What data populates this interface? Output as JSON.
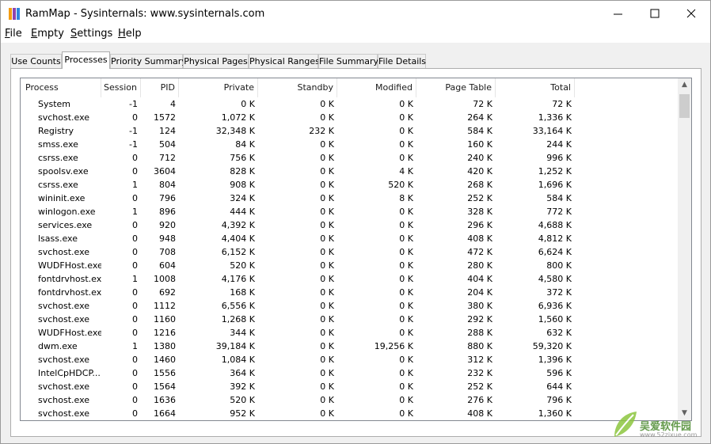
{
  "window": {
    "title": "RamMap - Sysinternals: www.sysinternals.com",
    "icon": "rammap-app-icon",
    "controls": {
      "minimize": "─",
      "maximize": "☐",
      "close": "✕"
    }
  },
  "menu": [
    {
      "label": "File",
      "access": "F",
      "rest": "ile"
    },
    {
      "label": "Empty",
      "access": "E",
      "rest": "mpty"
    },
    {
      "label": "Settings",
      "access": "S",
      "rest": "ettings"
    },
    {
      "label": "Help",
      "access": "H",
      "rest": "elp"
    }
  ],
  "tabs": [
    {
      "label": "Use Counts",
      "active": false
    },
    {
      "label": "Processes",
      "active": true
    },
    {
      "label": "Priority Summary",
      "active": false
    },
    {
      "label": "Physical Pages",
      "active": false
    },
    {
      "label": "Physical Ranges",
      "active": false
    },
    {
      "label": "File Summary",
      "active": false
    },
    {
      "label": "File Details",
      "active": false
    }
  ],
  "table": {
    "columns": [
      "Process",
      "Session",
      "PID",
      "Private",
      "Standby",
      "Modified",
      "Page Table",
      "Total"
    ],
    "rows": [
      [
        "System",
        "-1",
        "4",
        "0 K",
        "0 K",
        "0 K",
        "72 K",
        "72 K"
      ],
      [
        "svchost.exe",
        "0",
        "1572",
        "1,072 K",
        "0 K",
        "0 K",
        "264 K",
        "1,336 K"
      ],
      [
        "Registry",
        "-1",
        "124",
        "32,348 K",
        "232 K",
        "0 K",
        "584 K",
        "33,164 K"
      ],
      [
        "smss.exe",
        "-1",
        "504",
        "84 K",
        "0 K",
        "0 K",
        "160 K",
        "244 K"
      ],
      [
        "csrss.exe",
        "0",
        "712",
        "756 K",
        "0 K",
        "0 K",
        "240 K",
        "996 K"
      ],
      [
        "spoolsv.exe",
        "0",
        "3604",
        "828 K",
        "0 K",
        "4 K",
        "420 K",
        "1,252 K"
      ],
      [
        "csrss.exe",
        "1",
        "804",
        "908 K",
        "0 K",
        "520 K",
        "268 K",
        "1,696 K"
      ],
      [
        "wininit.exe",
        "0",
        "796",
        "324 K",
        "0 K",
        "8 K",
        "252 K",
        "584 K"
      ],
      [
        "winlogon.exe",
        "1",
        "896",
        "444 K",
        "0 K",
        "0 K",
        "328 K",
        "772 K"
      ],
      [
        "services.exe",
        "0",
        "920",
        "4,392 K",
        "0 K",
        "0 K",
        "296 K",
        "4,688 K"
      ],
      [
        "lsass.exe",
        "0",
        "948",
        "4,404 K",
        "0 K",
        "0 K",
        "408 K",
        "4,812 K"
      ],
      [
        "svchost.exe",
        "0",
        "708",
        "6,152 K",
        "0 K",
        "0 K",
        "472 K",
        "6,624 K"
      ],
      [
        "WUDFHost.exe",
        "0",
        "604",
        "520 K",
        "0 K",
        "0 K",
        "280 K",
        "800 K"
      ],
      [
        "fontdrvhost.ex",
        "1",
        "1008",
        "4,176 K",
        "0 K",
        "0 K",
        "404 K",
        "4,580 K"
      ],
      [
        "fontdrvhost.ex",
        "0",
        "692",
        "168 K",
        "0 K",
        "0 K",
        "204 K",
        "372 K"
      ],
      [
        "svchost.exe",
        "0",
        "1112",
        "6,556 K",
        "0 K",
        "0 K",
        "380 K",
        "6,936 K"
      ],
      [
        "svchost.exe",
        "0",
        "1160",
        "1,268 K",
        "0 K",
        "0 K",
        "292 K",
        "1,560 K"
      ],
      [
        "WUDFHost.exe",
        "0",
        "1216",
        "344 K",
        "0 K",
        "0 K",
        "288 K",
        "632 K"
      ],
      [
        "dwm.exe",
        "1",
        "1380",
        "39,184 K",
        "0 K",
        "19,256 K",
        "880 K",
        "59,320 K"
      ],
      [
        "svchost.exe",
        "0",
        "1460",
        "1,084 K",
        "0 K",
        "0 K",
        "312 K",
        "1,396 K"
      ],
      [
        "IntelCpHDCP...",
        "0",
        "1556",
        "364 K",
        "0 K",
        "0 K",
        "232 K",
        "596 K"
      ],
      [
        "svchost.exe",
        "0",
        "1564",
        "392 K",
        "0 K",
        "0 K",
        "252 K",
        "644 K"
      ],
      [
        "svchost.exe",
        "0",
        "1636",
        "520 K",
        "0 K",
        "0 K",
        "276 K",
        "796 K"
      ],
      [
        "svchost.exe",
        "0",
        "1664",
        "952 K",
        "0 K",
        "0 K",
        "408 K",
        "1,360 K"
      ]
    ]
  },
  "scrollbar": {
    "up": "▲",
    "down": "▼"
  },
  "watermark": {
    "text": "吴爱软件园",
    "url": "www.52zixue.com"
  },
  "colors": {
    "icon_orange": "#f39c12",
    "icon_purple": "#8e44ad",
    "icon_blue": "#2e86de"
  }
}
